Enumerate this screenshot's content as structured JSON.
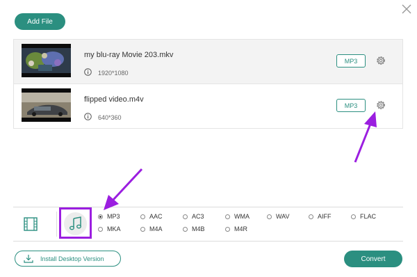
{
  "toolbar": {
    "add_file_label": "Add File"
  },
  "files": [
    {
      "name": "my blu-ray Movie 203.mkv",
      "resolution": "1920*1080",
      "format": "MP3"
    },
    {
      "name": "flipped video.m4v",
      "resolution": "640*360",
      "format": "MP3"
    }
  ],
  "audio_formats": {
    "selected": "MP3",
    "row1": [
      "MP3",
      "AAC",
      "AC3",
      "WMA",
      "WAV",
      "AIFF",
      "FLAC"
    ],
    "row2": [
      "MKA",
      "M4A",
      "M4B",
      "M4R"
    ]
  },
  "footer": {
    "install_label": "Install Desktop Version",
    "convert_label": "Convert"
  },
  "colors": {
    "accent": "#2b8f80",
    "highlight": "#9b1ee0"
  }
}
